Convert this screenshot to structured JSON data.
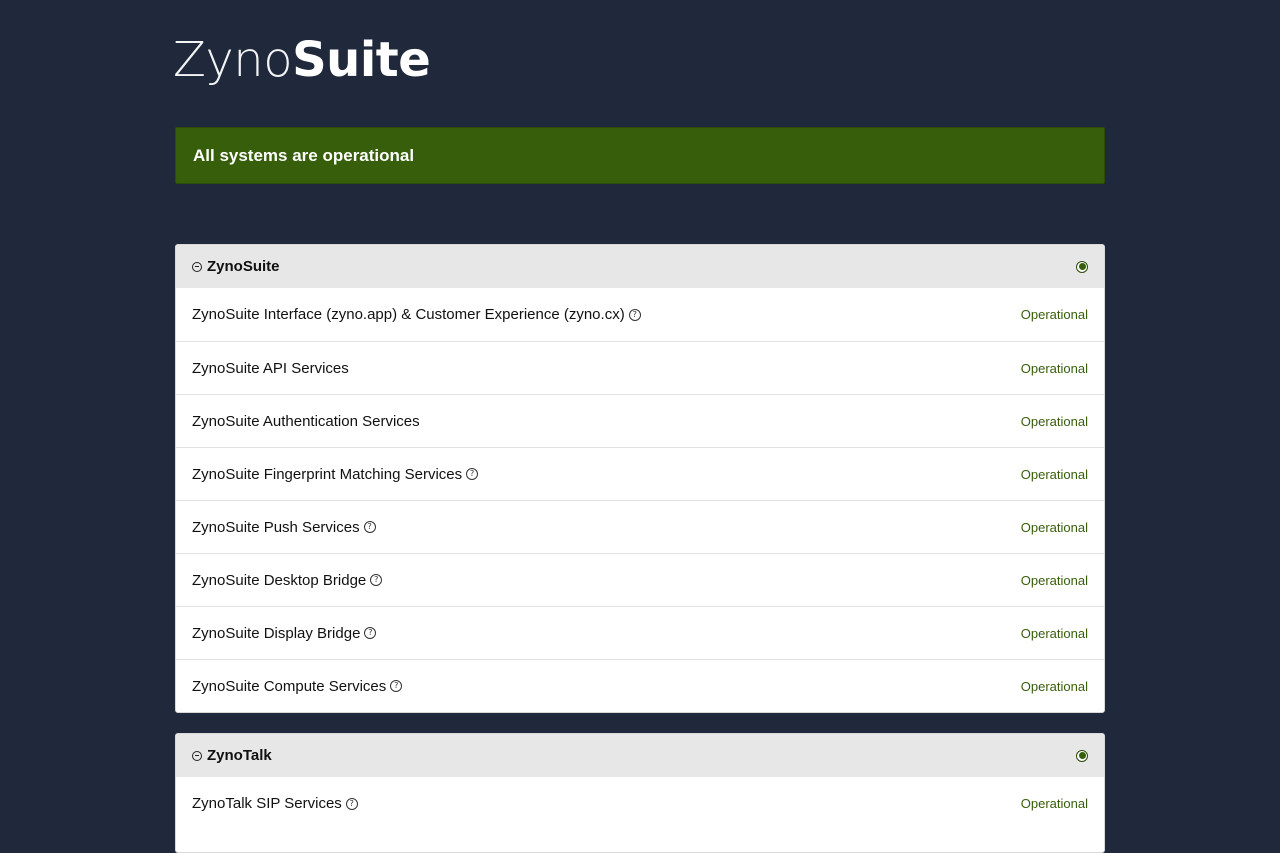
{
  "brand": {
    "thin": "Zyno",
    "bold": "Suite"
  },
  "banner": {
    "text": "All systems are operational",
    "color": "#375e0b"
  },
  "groups": [
    {
      "title": "ZynoSuite",
      "status_icon": "status-dot-icon",
      "components": [
        {
          "name": "ZynoSuite Interface (zyno.app) & Customer Experience (zyno.cx)",
          "help": true,
          "status": "Operational"
        },
        {
          "name": "ZynoSuite API Services",
          "help": false,
          "status": "Operational"
        },
        {
          "name": "ZynoSuite Authentication Services",
          "help": false,
          "status": "Operational"
        },
        {
          "name": "ZynoSuite Fingerprint Matching Services",
          "help": true,
          "status": "Operational"
        },
        {
          "name": "ZynoSuite Push Services",
          "help": true,
          "status": "Operational"
        },
        {
          "name": "ZynoSuite Desktop Bridge",
          "help": true,
          "status": "Operational"
        },
        {
          "name": "ZynoSuite Display Bridge",
          "help": true,
          "status": "Operational"
        },
        {
          "name": "ZynoSuite Compute Services",
          "help": true,
          "status": "Operational"
        }
      ]
    },
    {
      "title": "ZynoTalk",
      "status_icon": "status-dot-icon",
      "components": [
        {
          "name": "ZynoTalk SIP Services",
          "help": true,
          "status": "Operational"
        }
      ]
    }
  ],
  "help_glyph": "?"
}
